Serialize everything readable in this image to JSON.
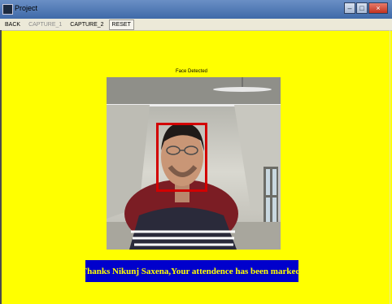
{
  "window": {
    "title": "Project",
    "controls": [
      "–",
      "□",
      "×"
    ]
  },
  "menubar": {
    "items": [
      {
        "label": "BACK",
        "enabled": true
      },
      {
        "label": "CAPTURE_1",
        "enabled": false
      },
      {
        "label": "CAPTURE_2",
        "enabled": true
      },
      {
        "label": "RESET",
        "enabled": true
      }
    ]
  },
  "camera": {
    "status_label": "Face Detected",
    "box_color": "#d20000"
  },
  "message": {
    "text": "Thanks Nikunj Saxena,Your attendence has been marked.",
    "bg_color": "#0000cc",
    "text_color": "#ffff00"
  },
  "background_color": "#ffff00"
}
